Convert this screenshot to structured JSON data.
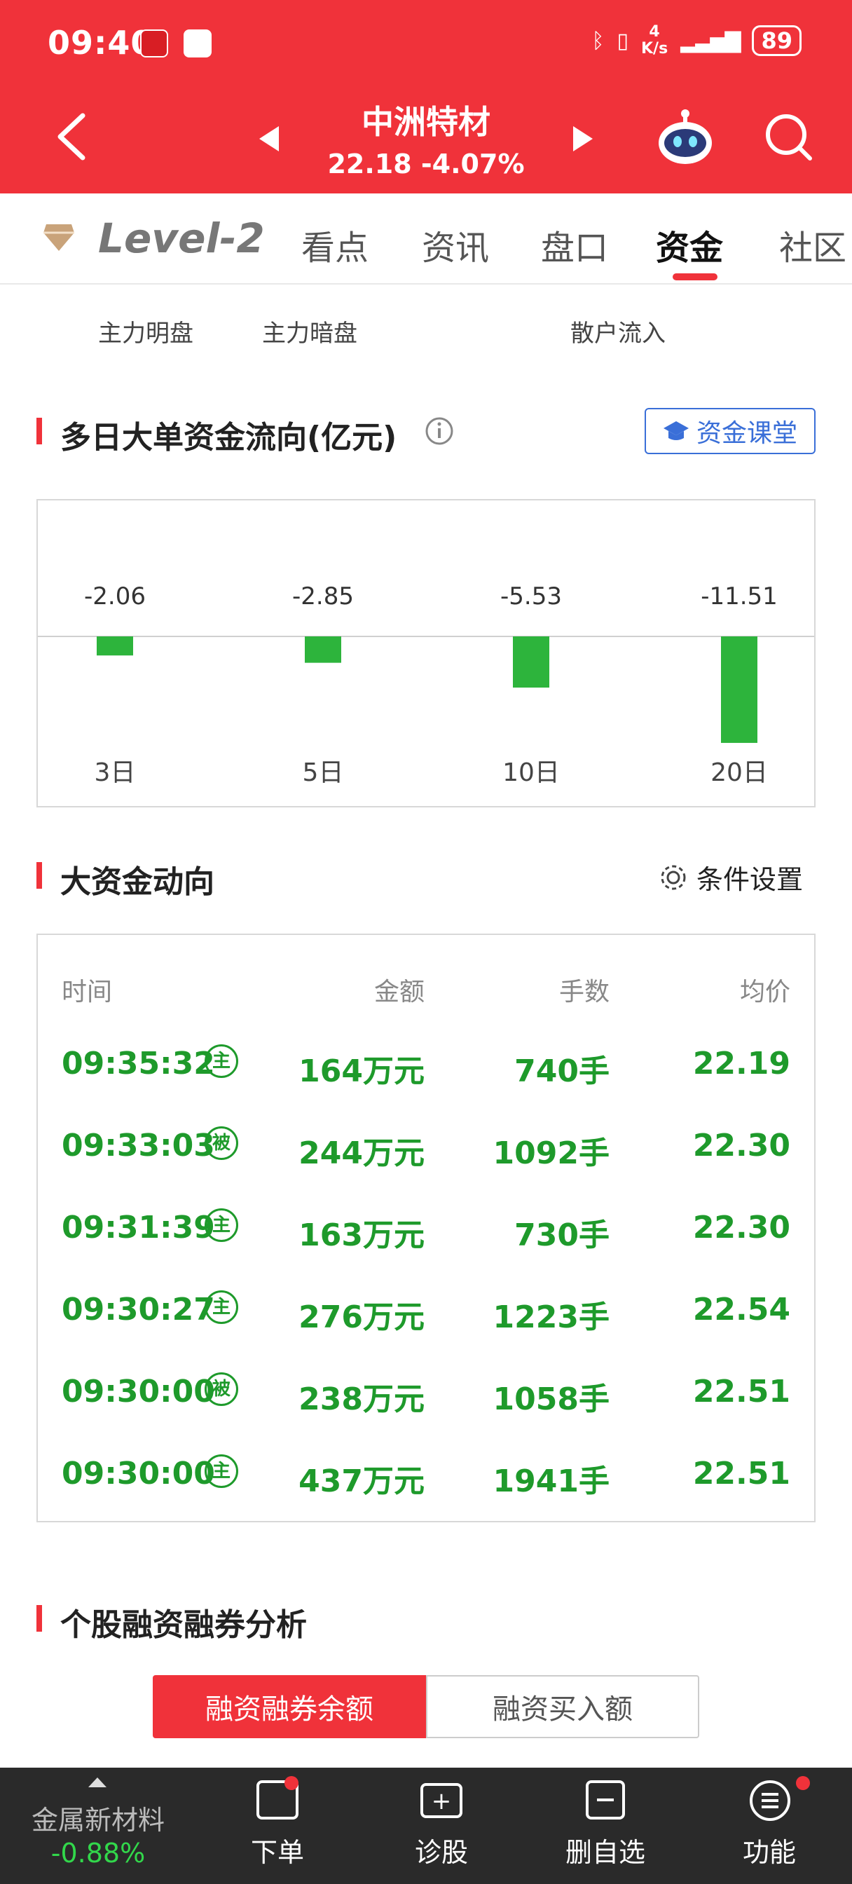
{
  "status": {
    "time": "09:40",
    "net_top": "4",
    "net_bottom": "K/s",
    "battery": "89"
  },
  "stock": {
    "name": "中洲特材",
    "price_line": "22.18 -4.07%"
  },
  "tabs": [
    {
      "label": "Level-2"
    },
    {
      "label": "看点"
    },
    {
      "label": "资讯"
    },
    {
      "label": "盘口"
    },
    {
      "label": "资金"
    },
    {
      "label": "社区"
    }
  ],
  "flow_labels": {
    "main_open": "主力明盘",
    "main_hidden": "主力暗盘",
    "retail": "散户流入"
  },
  "multi_day": {
    "title": "多日大单资金流向(亿元)",
    "classroom_label": "资金课堂"
  },
  "chart_data": {
    "type": "bar",
    "categories": [
      "3日",
      "5日",
      "10日",
      "20日"
    ],
    "values": [
      -2.06,
      -2.85,
      -5.53,
      -11.51
    ],
    "value_labels": [
      "-2.06",
      "-2.85",
      "-5.53",
      "-11.51"
    ],
    "colors": {
      "negative": "#2db43c"
    }
  },
  "big_money": {
    "title": "大资金动向",
    "settings_label": "条件设置",
    "columns": [
      "时间",
      "金额",
      "手数",
      "均价"
    ],
    "rows": [
      {
        "time": "09:35:32",
        "tag": "主",
        "amount": "164万元",
        "lots": "740手",
        "avg": "22.19"
      },
      {
        "time": "09:33:03",
        "tag": "被",
        "amount": "244万元",
        "lots": "1092手",
        "avg": "22.30"
      },
      {
        "time": "09:31:39",
        "tag": "主",
        "amount": "163万元",
        "lots": "730手",
        "avg": "22.30"
      },
      {
        "time": "09:30:27",
        "tag": "主",
        "amount": "276万元",
        "lots": "1223手",
        "avg": "22.54"
      },
      {
        "time": "09:30:00",
        "tag": "被",
        "amount": "238万元",
        "lots": "1058手",
        "avg": "22.51"
      },
      {
        "time": "09:30:00",
        "tag": "主",
        "amount": "437万元",
        "lots": "1941手",
        "avg": "22.51"
      }
    ]
  },
  "margin": {
    "title": "个股融资融券分析",
    "seg_active": "融资融券余额",
    "seg_inactive": "融资买入额"
  },
  "bottom_nav": {
    "sector_name": "金属新材料",
    "sector_change": "-0.88%",
    "items": [
      {
        "label": "下单"
      },
      {
        "label": "诊股"
      },
      {
        "label": "删自选"
      },
      {
        "label": "功能"
      }
    ]
  },
  "colors": {
    "brand": "#f0323a",
    "down": "#1e9a2b",
    "bottom_bg": "#2a2a2a"
  }
}
